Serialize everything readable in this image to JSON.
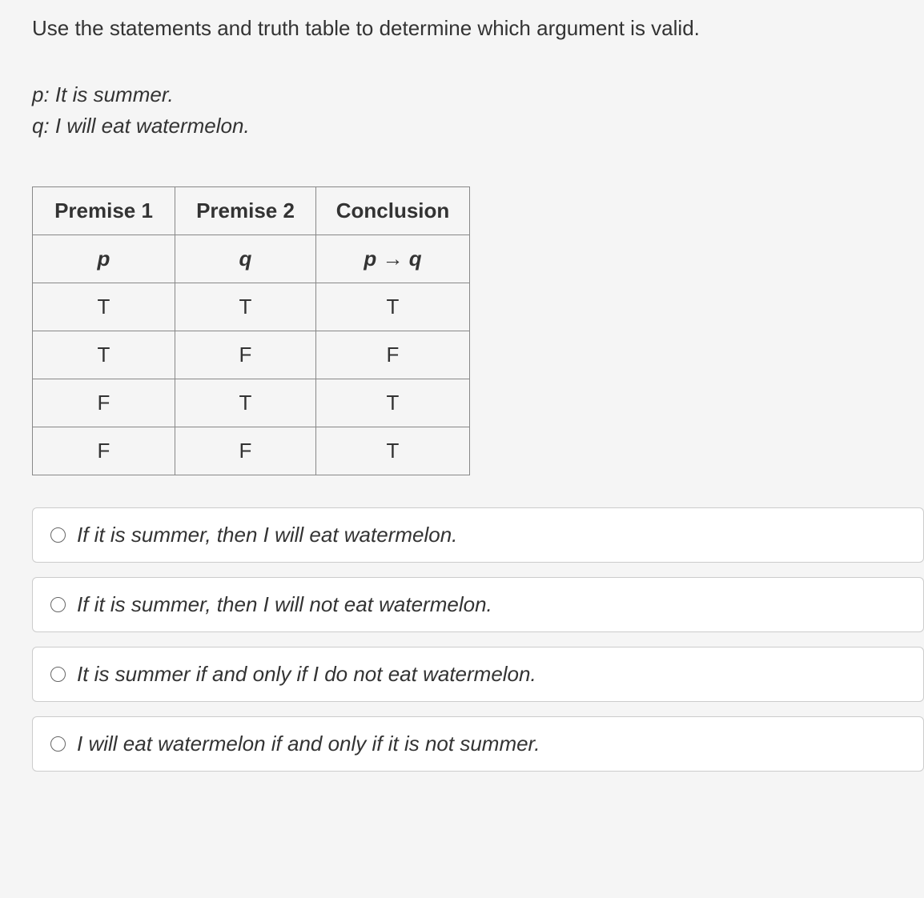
{
  "question": "Use the statements and truth table to determine which argument is valid.",
  "statements": {
    "p": "p: It is summer.",
    "q": "q: I will eat watermelon."
  },
  "table": {
    "headers": [
      "Premise 1",
      "Premise 2",
      "Conclusion"
    ],
    "subheaders": {
      "p": "p",
      "q": "q",
      "pq_left": "p",
      "pq_arrow": "→",
      "pq_right": "q"
    },
    "rows": [
      [
        "T",
        "T",
        "T"
      ],
      [
        "T",
        "F",
        "F"
      ],
      [
        "F",
        "T",
        "T"
      ],
      [
        "F",
        "F",
        "T"
      ]
    ]
  },
  "options": [
    "If it is summer, then I will eat watermelon.",
    "If it is summer, then I will not eat watermelon.",
    "It is summer if and only if I do not eat watermelon.",
    "I will eat watermelon if and only if it is not summer."
  ]
}
